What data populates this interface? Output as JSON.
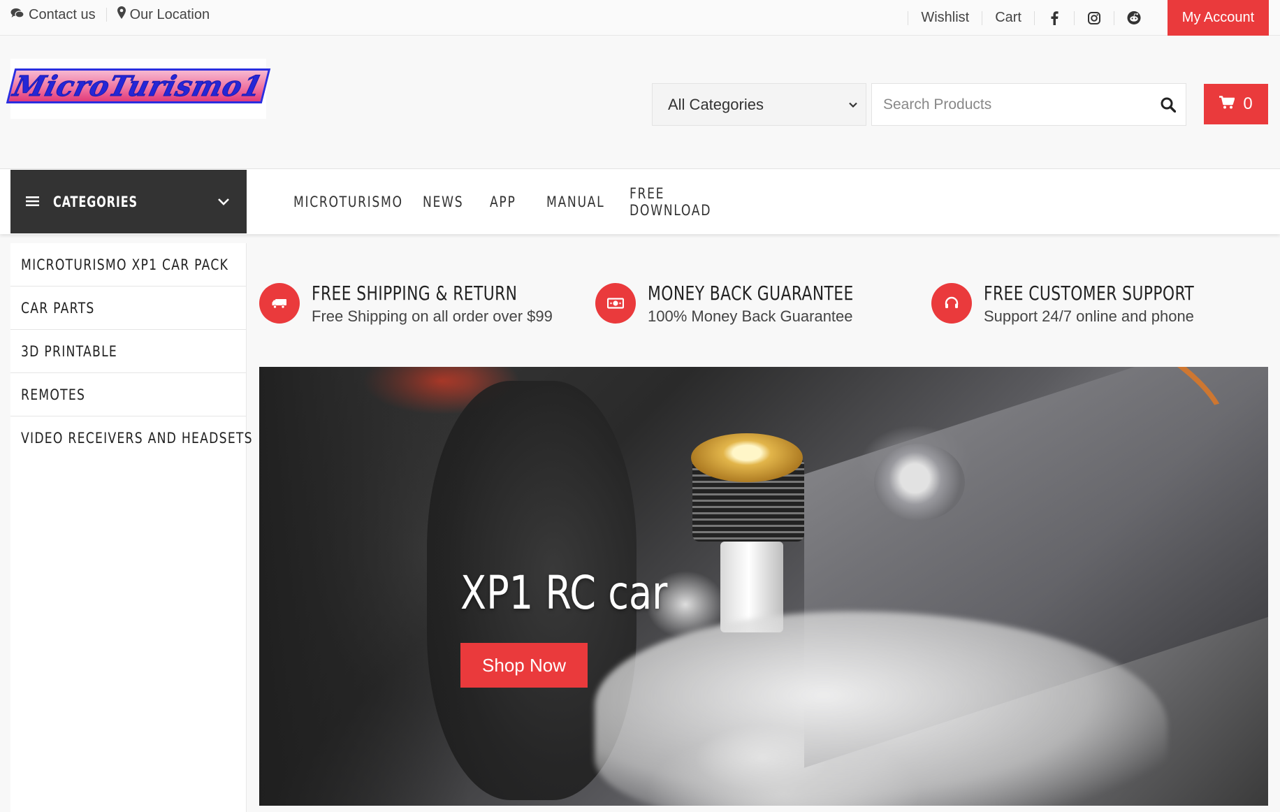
{
  "topbar": {
    "contact_label": "Contact us",
    "location_label": "Our Location",
    "wishlist_label": "Wishlist",
    "cart_label": "Cart",
    "account_label": "My Account",
    "social_icons": [
      "facebook-icon",
      "instagram-icon",
      "reddit-icon"
    ]
  },
  "header": {
    "logo_text": "MicroTurismo1",
    "category_select": "All Categories",
    "search_placeholder": "Search Products",
    "cart_count": "0"
  },
  "nav": {
    "categories_label": "CATEGORIES",
    "menu": [
      "MICROTURISMO",
      "NEWS",
      "APP",
      "MANUAL",
      "FREE DOWNLOAD"
    ]
  },
  "sidebar": {
    "items": [
      "MICROTURISMO XP1 CAR PACK",
      "CAR PARTS",
      "3D PRINTABLE",
      "REMOTES",
      "VIDEO RECEIVERS AND HEADSETS"
    ]
  },
  "features": [
    {
      "title": "FREE SHIPPING & RETURN",
      "subtitle": "Free Shipping on all order over $99",
      "icon": "truck-icon"
    },
    {
      "title": "MONEY BACK GUARANTEE",
      "subtitle": "100% Money Back Guarantee",
      "icon": "money-icon"
    },
    {
      "title": "FREE CUSTOMER SUPPORT",
      "subtitle": "Support 24/7 online and phone",
      "icon": "headset-icon"
    }
  ],
  "banner": {
    "title": "XP1 RC car",
    "button_label": "Shop Now"
  },
  "colors": {
    "accent": "#ea3a3c",
    "dark": "#333333",
    "background": "#f8f8f8"
  }
}
